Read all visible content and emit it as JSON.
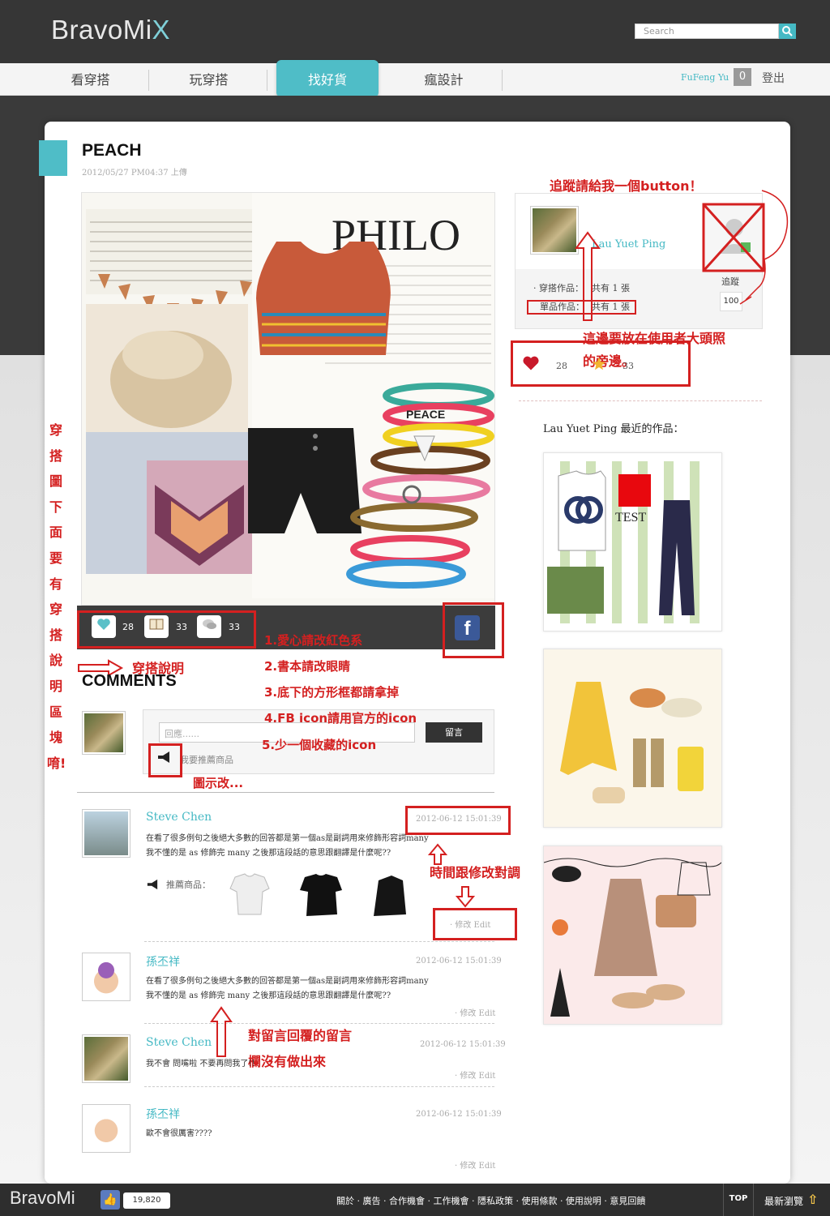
{
  "header": {
    "logo_text": "BravoMi",
    "logo_swoosh": "X",
    "search_placeholder": "Search",
    "search_icon": "magnifier-icon"
  },
  "nav": {
    "items": [
      "看穿搭",
      "玩穿搭",
      "找好貨",
      "瘋設計"
    ],
    "active_index": 2,
    "username": "FuFeng Yu",
    "notification_count": "0",
    "logout": "登出"
  },
  "post": {
    "title": "PEACH",
    "uploaded": "2012/05/27 PM04:37 上傳",
    "collage_text_1": "PHILO",
    "collage_text_2": "PEACE",
    "collage_caption": "spring/summer collections for glamour-after-dark from the highlights of McQueen's floral brocade, Cartney's rainbow stripes, Wang's leather to the rich hues of Ferragamo, Art Deco delights of Gucci, the lace ethereal beauty of Givenchy's artistic chain lace dresses. Angelic babies to gives like of the. Photographed by Simon U. Styled by Kenneth G.",
    "stats": [
      {
        "icon": "heart-icon",
        "count": "28"
      },
      {
        "icon": "book-icon",
        "count": "33"
      },
      {
        "icon": "chat-bubble-icon",
        "count": "33"
      }
    ],
    "fb_icon": "facebook-icon"
  },
  "comments": {
    "title": "COMMENTS",
    "reply_placeholder": "回應......",
    "reply_button": "留言",
    "recommend_label": "我要推薦商品",
    "items": [
      {
        "name": "Steve Chen",
        "time": "2012-06-12 15:01:39",
        "text1": "在看了很多例句之後絕大多數的回答都是第一個as是副詞用來修飾形容詞many",
        "text2": "我不懂的是 as 修飾完 many 之後那這段話的意思跟翻譯是什麼呢??",
        "recommend": "推薦商品：",
        "edit": "· 修改 Edit"
      },
      {
        "name": "孫丕祥",
        "time": "2012-06-12 15:01:39",
        "text1": "在看了很多例句之後絕大多數的回答都是第一個as是副詞用來修飾形容詞many",
        "text2": "我不懂的是 as 修飾完 many 之後那這段話的意思跟翻譯是什麼呢??",
        "edit": "· 修改 Edit"
      },
      {
        "name": "Steve Chen",
        "time": "2012-06-12 15:01:39",
        "text1": "我不會 問嘴啦 不要再問我了!!",
        "edit": "· 修改 Edit"
      },
      {
        "name": "孫丕祥",
        "time": "2012-06-12 15:01:39",
        "text1": "歐不會很厲害????",
        "edit": "· 修改 Edit"
      }
    ]
  },
  "profile": {
    "name": "Lau Yuet Ping",
    "works_label": "· 穿搭作品：",
    "works_value": "共有 1 張",
    "single_label": "單品作品：",
    "single_value": "共有 1 張",
    "follow_label": "追蹤",
    "follow_count": "100",
    "like_count": "28",
    "star_count": "33",
    "recent_title": "Lau Yuet Ping 最近的作品：",
    "thumb1_text": "TEST"
  },
  "annotations": {
    "follow_note": "追蹤請給我一個button！",
    "avatar_note_1": "這邊要放在使用者大頭照",
    "avatar_note_2": "的旁邊。",
    "left_vertical": [
      "穿",
      "搭",
      "圖",
      "下",
      "面",
      "要",
      "有",
      "穿",
      "搭",
      "說",
      "明",
      "區",
      "塊",
      "唷!"
    ],
    "desc_note": "穿搭說明",
    "notes": [
      "1.愛心請改紅色系",
      "2.書本請改眼睛",
      "3.底下的方形框都請拿掉",
      "4.FB icon請用官方的icon",
      "5.少一個收藏的icon"
    ],
    "icon_note": "圖示改...",
    "time_note": "時間跟修改對調",
    "reply_note_1": "對留言回覆的留言",
    "reply_note_2": "欄沒有做出來"
  },
  "footer": {
    "logo_text": "BravoMi",
    "like_count": "19,820",
    "links": "關於 · 廣告 · 合作機會 · 工作機會 · 隱私政策 · 使用條款 · 使用說明 · 意見回饋",
    "top": "TOP",
    "latest": "最新瀏覽"
  },
  "colors": {
    "accent": "#4fbdc7",
    "annotation_red": "#d42020",
    "header_bg": "#363636"
  }
}
